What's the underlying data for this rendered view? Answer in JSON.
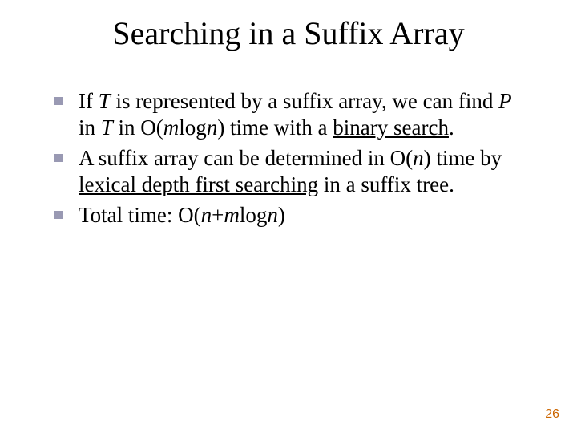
{
  "title": "Searching in a Suffix Array",
  "bullets": [
    {
      "pre1": "If ",
      "T": "T",
      "mid1": " is represented by a suffix array, we can find ",
      "P": "P",
      "mid2": " in ",
      "T2": "T",
      "mid3": " in O(",
      "m": "m",
      "log": "log",
      "n": "n",
      "close": ") time with a ",
      "link": "binary search",
      "dot": "."
    },
    {
      "pre": "A suffix array can be determined in O(",
      "n": "n",
      "mid": ") time by ",
      "link": "lexical depth first searching",
      "post": " in a suffix tree."
    },
    {
      "pre": "Total time: O(",
      "n1": "n",
      "plus": "+",
      "m": "m",
      "log": "log",
      "n2": "n",
      "close": ")"
    }
  ],
  "page": "26"
}
